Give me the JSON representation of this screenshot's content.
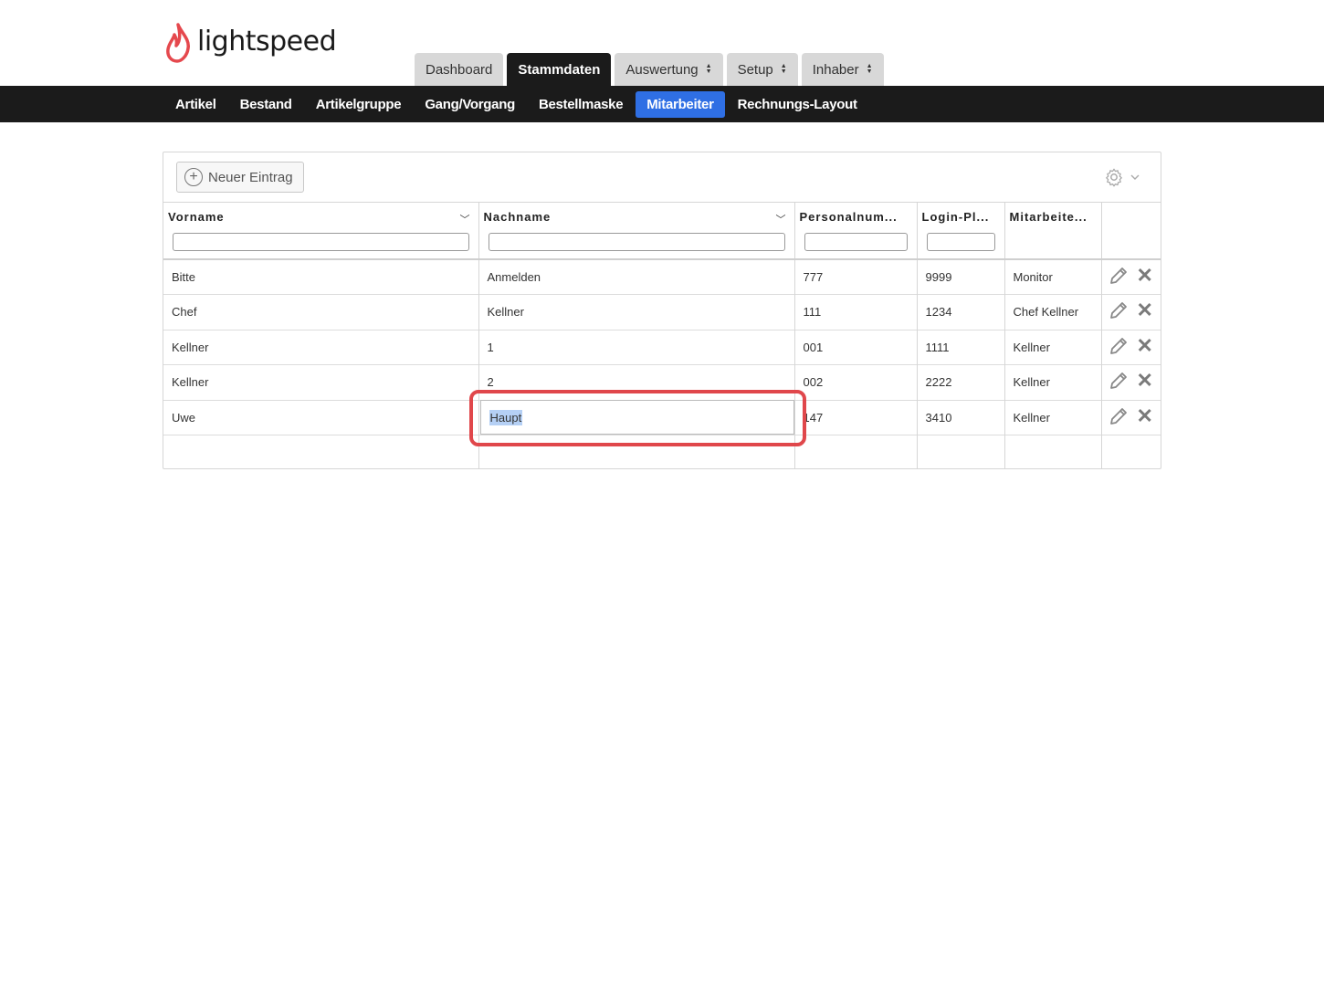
{
  "brand": {
    "name": "lightspeed"
  },
  "main_tabs": [
    {
      "label": "Dashboard",
      "active": false,
      "dropdown": false
    },
    {
      "label": "Stammdaten",
      "active": true,
      "dropdown": false
    },
    {
      "label": "Auswertung",
      "active": false,
      "dropdown": true
    },
    {
      "label": "Setup",
      "active": false,
      "dropdown": true
    },
    {
      "label": "Inhaber",
      "active": false,
      "dropdown": true
    }
  ],
  "sub_nav": [
    {
      "label": "Artikel",
      "active": false
    },
    {
      "label": "Bestand",
      "active": false
    },
    {
      "label": "Artikelgruppe",
      "active": false
    },
    {
      "label": "Gang/Vorgang",
      "active": false
    },
    {
      "label": "Bestellmaske",
      "active": false
    },
    {
      "label": "Mitarbeiter",
      "active": true
    },
    {
      "label": "Rechnungs-Layout",
      "active": false
    }
  ],
  "toolbar": {
    "new_entry_label": "Neuer Eintrag"
  },
  "table": {
    "columns": [
      "Vorname",
      "Nachname",
      "Personalnum...",
      "Login-Pl...",
      "Mitarbeite..."
    ],
    "rows": [
      [
        "Bitte",
        "Anmelden",
        "777",
        "9999",
        "Monitor"
      ],
      [
        "Chef",
        "Kellner",
        "111",
        "1234",
        "Chef Kellner"
      ],
      [
        "Kellner",
        "1",
        "001",
        "1111",
        "Kellner"
      ],
      [
        "Kellner",
        "2",
        "002",
        "2222",
        "Kellner"
      ],
      [
        "Uwe",
        "",
        "147",
        "3410",
        "Kellner"
      ]
    ],
    "editing": {
      "row": 4,
      "column": "Nachname",
      "value": "Haupt"
    }
  },
  "colors": {
    "accent": "#2f6fe4",
    "nav_bg": "#1b1b1b",
    "highlight": "#e0474b",
    "brand": "#e5484d"
  }
}
